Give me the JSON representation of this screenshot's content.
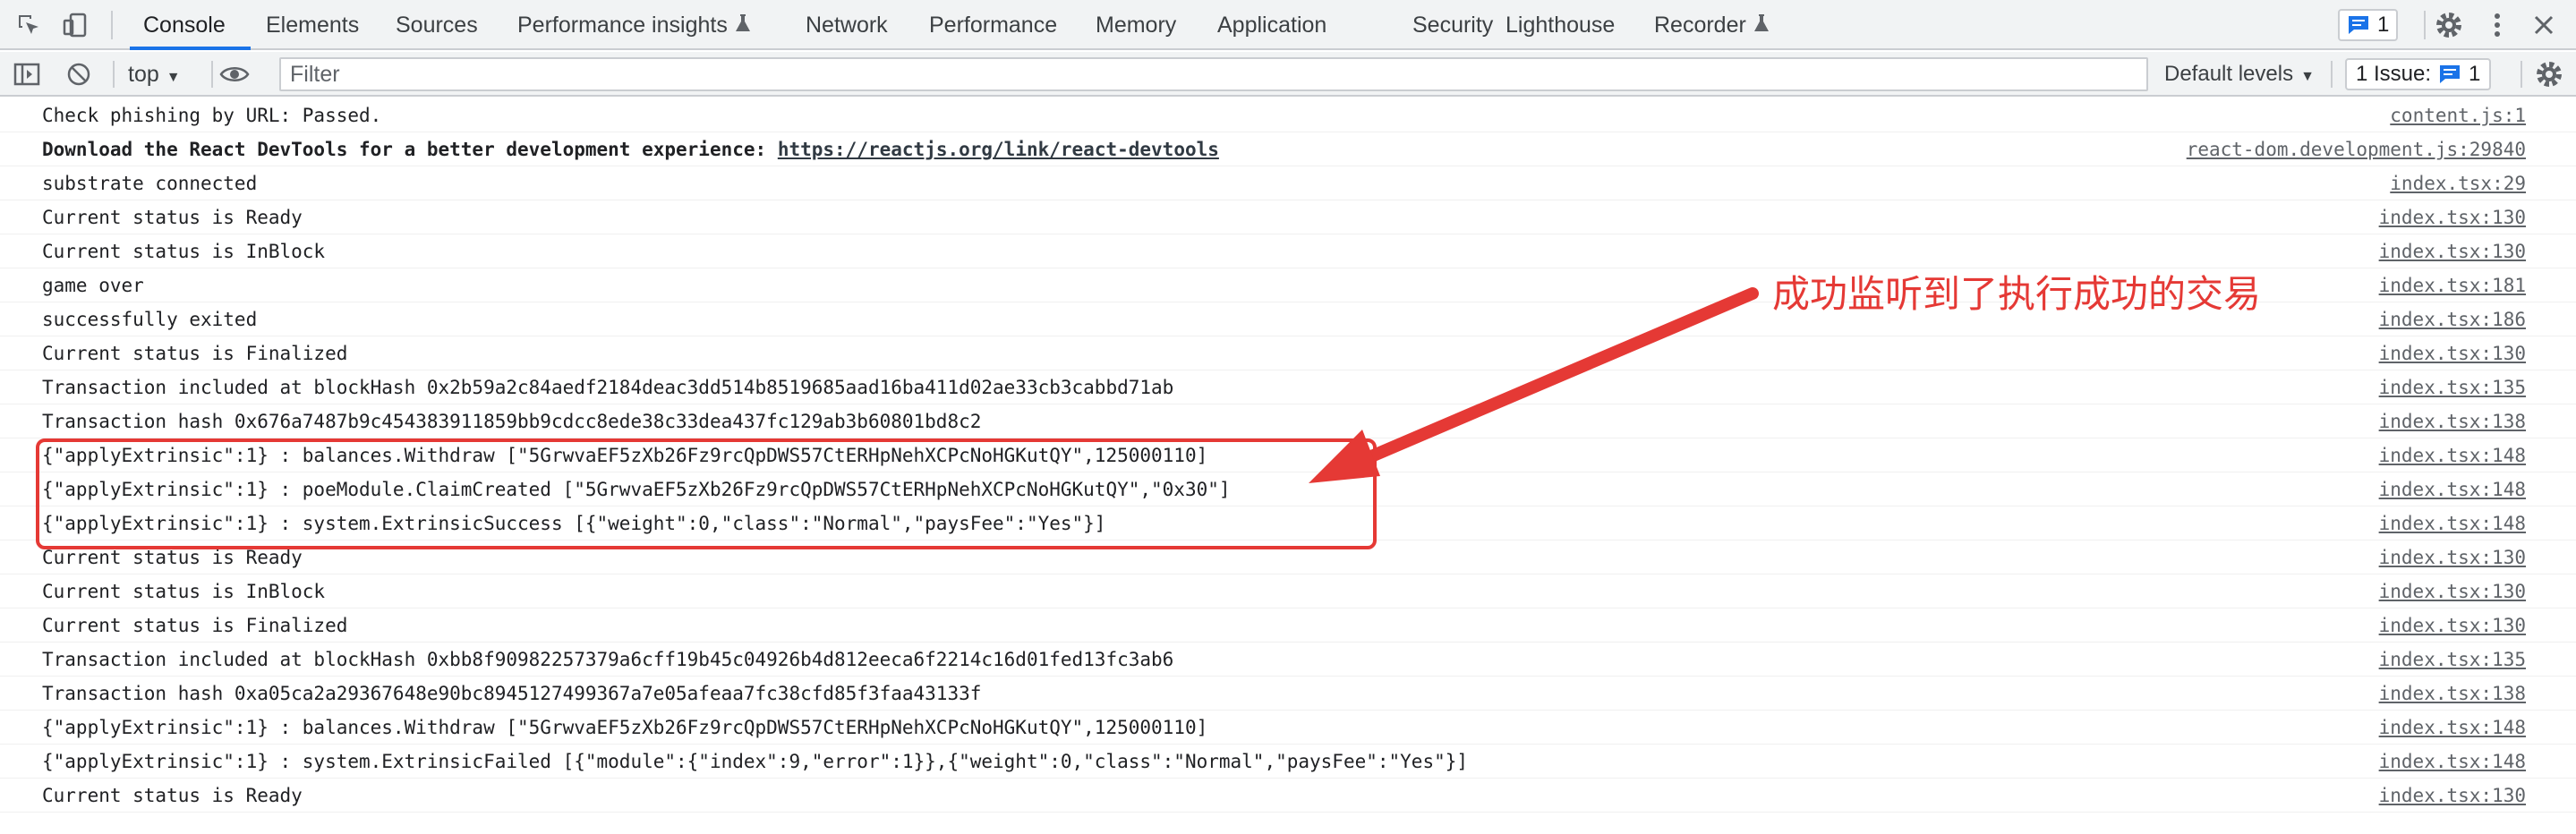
{
  "tabs": [
    {
      "label": "Console",
      "active": true
    },
    {
      "label": "Elements"
    },
    {
      "label": "Sources"
    },
    {
      "label": "Performance insights"
    },
    {
      "label": "Network"
    },
    {
      "label": "Performance"
    },
    {
      "label": "Memory"
    },
    {
      "label": "Application"
    },
    {
      "label": "Security"
    },
    {
      "label": "Lighthouse"
    },
    {
      "label": "Recorder"
    }
  ],
  "header": {
    "message_count": "1",
    "icons": [
      "inspect-element-icon",
      "device-toolbar-icon",
      "settings-gear-icon",
      "more-options-icon",
      "close-icon"
    ]
  },
  "toolbar": {
    "context": "top",
    "filter_placeholder": "Filter",
    "levels": "Default levels",
    "issues_label": "1 Issue:",
    "issues_count": "1"
  },
  "console": {
    "rows": [
      {
        "text": "Check phishing by URL: Passed.",
        "source": "content.js:1"
      },
      {
        "text": "Download the React DevTools for a better development experience: ",
        "link": "https://reactjs.org/link/react-devtools",
        "source": "react-dom.development.js:29840",
        "bold": true
      },
      {
        "text": "substrate connected",
        "source": "index.tsx:29"
      },
      {
        "text": "Current status is Ready",
        "source": "index.tsx:130"
      },
      {
        "text": "Current status is InBlock",
        "source": "index.tsx:130"
      },
      {
        "text": "game over",
        "source": "index.tsx:181"
      },
      {
        "text": "successfully exited",
        "source": "index.tsx:186"
      },
      {
        "text": "Current status is Finalized",
        "source": "index.tsx:130"
      },
      {
        "text": "Transaction included at blockHash 0x2b59a2c84aedf2184deac3dd514b8519685aad16ba411d02ae33cb3cabbd71ab",
        "source": "index.tsx:135"
      },
      {
        "text": "Transaction hash 0x676a7487b9c454383911859bb9cdcc8ede38c33dea437fc129ab3b60801bd8c2",
        "source": "index.tsx:138"
      },
      {
        "text": "{\"applyExtrinsic\":1} : balances.Withdraw [\"5GrwvaEF5zXb26Fz9rcQpDWS57CtERHpNehXCPcNoHGKutQY\",125000110]",
        "source": "index.tsx:148"
      },
      {
        "text": "{\"applyExtrinsic\":1} : poeModule.ClaimCreated [\"5GrwvaEF5zXb26Fz9rcQpDWS57CtERHpNehXCPcNoHGKutQY\",\"0x30\"]",
        "source": "index.tsx:148"
      },
      {
        "text": "{\"applyExtrinsic\":1} : system.ExtrinsicSuccess [{\"weight\":0,\"class\":\"Normal\",\"paysFee\":\"Yes\"}]",
        "source": "index.tsx:148"
      },
      {
        "text": "Current status is Ready",
        "source": "index.tsx:130"
      },
      {
        "text": "Current status is InBlock",
        "source": "index.tsx:130"
      },
      {
        "text": "Current status is Finalized",
        "source": "index.tsx:130"
      },
      {
        "text": "Transaction included at blockHash 0xbb8f90982257379a6cff19b45c04926b4d812eeca6f2214c16d01fed13fc3ab6",
        "source": "index.tsx:135"
      },
      {
        "text": "Transaction hash 0xa05ca2a29367648e90bc8945127499367a7e05afeaa7fc38cfd85f3faa43133f",
        "source": "index.tsx:138"
      },
      {
        "text": "{\"applyExtrinsic\":1} : balances.Withdraw [\"5GrwvaEF5zXb26Fz9rcQpDWS57CtERHpNehXCPcNoHGKutQY\",125000110]",
        "source": "index.tsx:148"
      },
      {
        "text": "{\"applyExtrinsic\":1} : system.ExtrinsicFailed [{\"module\":{\"index\":9,\"error\":1}},{\"weight\":0,\"class\":\"Normal\",\"paysFee\":\"Yes\"}]",
        "source": "index.tsx:148"
      },
      {
        "text": "Current status is Ready",
        "source": "index.tsx:130"
      }
    ]
  },
  "annotation": {
    "text": "成功监听到了执行成功的交易",
    "color": "#e53935"
  },
  "colors": {
    "accent": "#1a73e8",
    "toolbar_bg": "#f1f3f4"
  }
}
